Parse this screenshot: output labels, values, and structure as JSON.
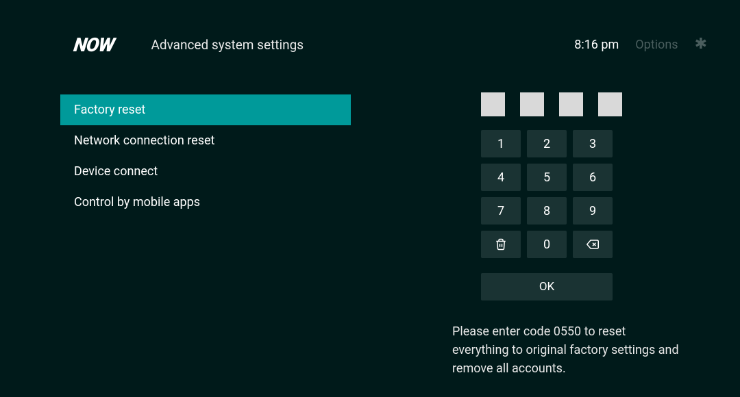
{
  "header": {
    "logo": "NOW",
    "title": "Advanced system settings",
    "time": "8:16 pm",
    "options_label": "Options"
  },
  "menu": {
    "items": [
      {
        "label": "Factory reset",
        "selected": true
      },
      {
        "label": "Network connection reset",
        "selected": false
      },
      {
        "label": "Device connect",
        "selected": false
      },
      {
        "label": "Control by mobile apps",
        "selected": false
      }
    ]
  },
  "keypad": {
    "keys": [
      "1",
      "2",
      "3",
      "4",
      "5",
      "6",
      "7",
      "8",
      "9"
    ],
    "zero": "0",
    "ok_label": "OK"
  },
  "instruction": "Please enter code 0550 to reset everything to original factory settings and remove all accounts."
}
